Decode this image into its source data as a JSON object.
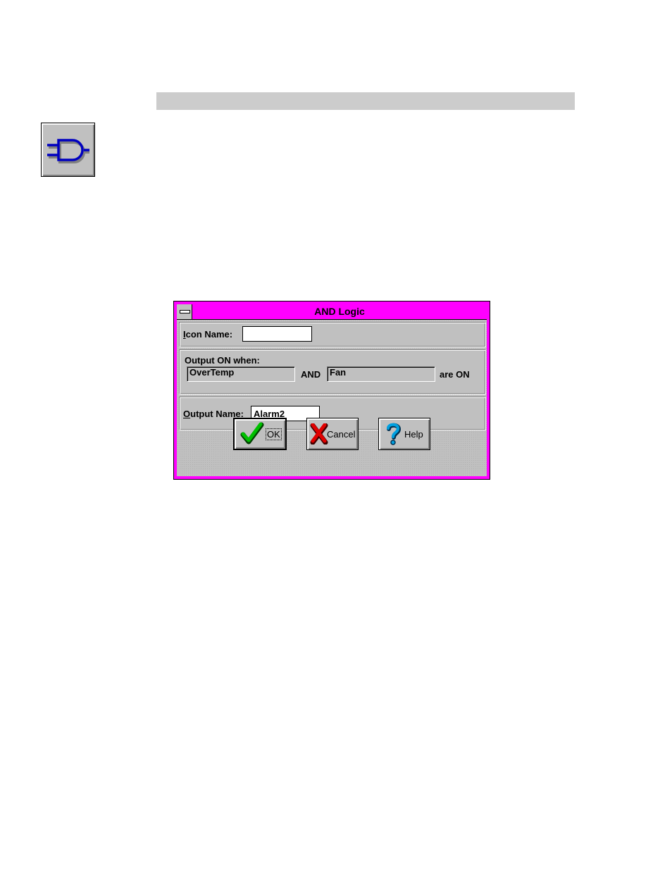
{
  "dialog": {
    "title": "AND Logic",
    "icon_name": {
      "label_u": "I",
      "label_rest": "con Name:",
      "value": ""
    },
    "output_on": {
      "label": "Output ON when:",
      "input1": "OverTemp",
      "and_label": "AND",
      "input2": "Fan",
      "suffix": "are ON"
    },
    "output_name": {
      "label_u": "O",
      "label_rest": "utput Name:",
      "value": "Alarm2"
    },
    "buttons": {
      "ok": "OK",
      "cancel": "Cancel",
      "help": "Help"
    }
  },
  "colors": {
    "titlebar": "#ff00ff",
    "face": "#c0c0c0",
    "gate": "#0000c0"
  },
  "icons": {
    "gate": "and-gate-icon",
    "ok": "checkmark-icon",
    "cancel": "x-icon",
    "help": "question-icon"
  }
}
